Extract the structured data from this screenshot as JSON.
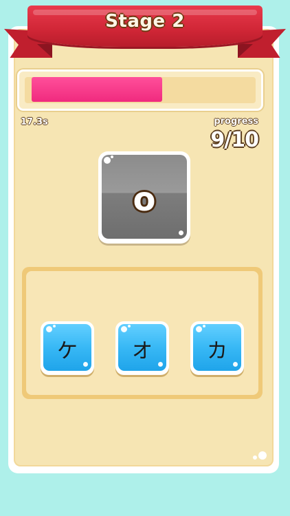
{
  "header": {
    "title": "Stage 2"
  },
  "timer": {
    "text": "17.3s",
    "fill_fraction": 0.6
  },
  "progress": {
    "label": "progress",
    "value": "9/10"
  },
  "question": {
    "character": "o"
  },
  "choices": [
    {
      "character": "ケ"
    },
    {
      "character": "オ"
    },
    {
      "character": "カ"
    }
  ],
  "colors": {
    "background": "#aef0ea",
    "ribbon": "#d02636",
    "card": "#f6e5b3",
    "timer_fill": "#f02a7e",
    "question_tile": "#8c8c8c",
    "choice_tile": "#38b8f5"
  }
}
